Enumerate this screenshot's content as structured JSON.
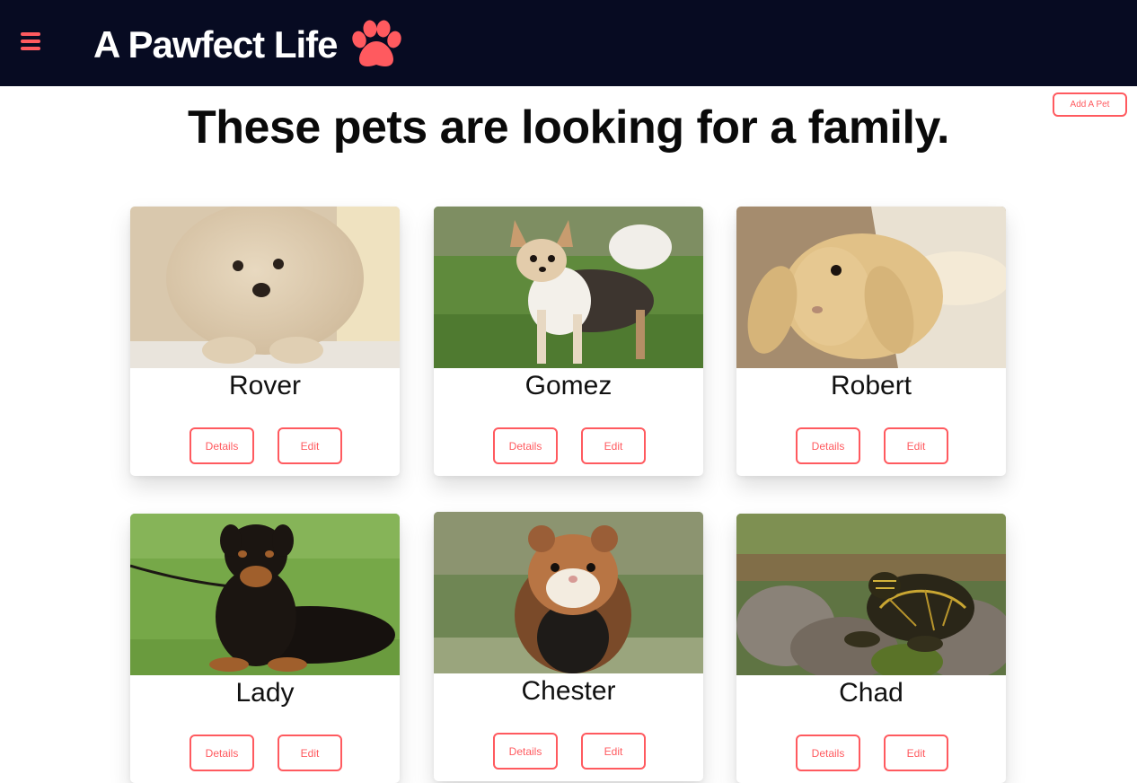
{
  "header": {
    "title": "A Pawfect Life",
    "menu_icon": "hamburger-icon",
    "logo_icon": "paw-icon",
    "accent_color": "#ff5a5f",
    "background_color": "#070b22"
  },
  "actions": {
    "add_pet_label": "Add A Pet"
  },
  "main": {
    "heading": "These pets are looking for a family."
  },
  "pets": [
    {
      "name": "Rover",
      "details_label": "Details",
      "edit_label": "Edit"
    },
    {
      "name": "Gomez",
      "details_label": "Details",
      "edit_label": "Edit"
    },
    {
      "name": "Robert",
      "details_label": "Details",
      "edit_label": "Edit"
    },
    {
      "name": "Lady",
      "details_label": "Details",
      "edit_label": "Edit"
    },
    {
      "name": "Chester",
      "details_label": "Details",
      "edit_label": "Edit"
    },
    {
      "name": "Chad",
      "details_label": "Details",
      "edit_label": "Edit"
    }
  ]
}
